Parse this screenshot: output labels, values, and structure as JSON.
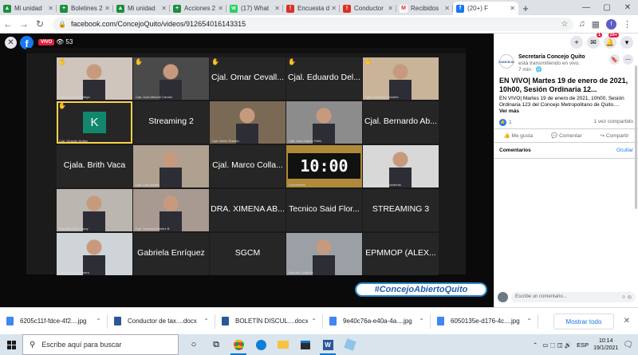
{
  "browser": {
    "tabs": [
      {
        "label": "Mi unidad",
        "color": "#1e8e3e",
        "glyph": "▲"
      },
      {
        "label": "Boletines 2",
        "color": "#1e8e3e",
        "glyph": "+"
      },
      {
        "label": "Mi unidad",
        "color": "#1e8e3e",
        "glyph": "▲"
      },
      {
        "label": "Acciones 2",
        "color": "#1e8e3e",
        "glyph": "+"
      },
      {
        "label": "(17) What",
        "color": "#25d366",
        "glyph": "w"
      },
      {
        "label": "Encuesta d",
        "color": "#d93025",
        "glyph": "!"
      },
      {
        "label": "Conductor",
        "color": "#d93025",
        "glyph": "!"
      },
      {
        "label": "Recibidos",
        "color": "#ffffff",
        "glyph": "M"
      },
      {
        "label": "(20+) F",
        "color": "#1877f2",
        "glyph": "f"
      }
    ],
    "url": "facebook.com/ConcejoQuito/videos/912654016143315",
    "profile_initial": "f"
  },
  "video": {
    "live_label": "VIVO",
    "viewers": "53",
    "hashtag": "#ConcejoAbiertoQuito",
    "clock": "10:00",
    "tiles": [
      {
        "row": 0,
        "col": 0,
        "name": "",
        "cap": "Cjala. Andrea Hidalgo",
        "hand": true,
        "photo": true,
        "bg": "#cfc5bd"
      },
      {
        "row": 0,
        "col": 1,
        "name": "",
        "cap": "Cjal. Juan Manuel Carrion",
        "hand": true,
        "photo": true,
        "bg": "#4a4a4a"
      },
      {
        "row": 0,
        "col": 2,
        "name": "Cjal. Omar Cevall...",
        "cap": "",
        "hand": true,
        "photo": false
      },
      {
        "row": 0,
        "col": 3,
        "name": "Cjal. Eduardo Del...",
        "cap": "",
        "hand": true,
        "photo": false
      },
      {
        "row": 0,
        "col": 4,
        "name": "",
        "cap": "Cjal. Fernando Morales",
        "hand": true,
        "photo": true,
        "bg": "#c9b49a"
      },
      {
        "row": 1,
        "col": 0,
        "name": "",
        "cap": "Cjal. Orlando Núñez",
        "hand": true,
        "photo": false,
        "avatar": "K",
        "selected": true
      },
      {
        "row": 1,
        "col": 1,
        "name": "Streaming 2",
        "cap": "",
        "hand": false,
        "photo": false
      },
      {
        "row": 1,
        "col": 2,
        "name": "",
        "cap": "Cjal. Mario Granda",
        "hand": false,
        "photo": true,
        "bg": "#7a6a55"
      },
      {
        "row": 1,
        "col": 3,
        "name": "",
        "cap": "Cjal. Juan Carlos Fiallo",
        "hand": false,
        "photo": true,
        "bg": "#8c8c8c"
      },
      {
        "row": 1,
        "col": 4,
        "name": "Cjal. Bernardo Ab...",
        "cap": "",
        "hand": false,
        "photo": false
      },
      {
        "row": 2,
        "col": 0,
        "name": "Cjala. Brith Vaca",
        "cap": "",
        "hand": false,
        "photo": false
      },
      {
        "row": 2,
        "col": 1,
        "name": "",
        "cap": "Cjal. Luis Robles",
        "hand": false,
        "photo": true,
        "bg": "#b0a090"
      },
      {
        "row": 2,
        "col": 2,
        "name": "Cjal. Marco Colla...",
        "cap": "",
        "hand": false,
        "photo": false
      },
      {
        "row": 2,
        "col": 3,
        "name": "",
        "cap": "Cronómetro",
        "hand": false,
        "photo": false,
        "clock": true
      },
      {
        "row": 2,
        "col": 4,
        "name": "",
        "cap": "Cjal. Santiago Guarderas",
        "hand": false,
        "photo": true,
        "bg": "#d8d8d8"
      },
      {
        "row": 3,
        "col": 0,
        "name": "",
        "cap": "Damaris Ortiz Pasuy",
        "hand": false,
        "photo": true,
        "bg": "#bcb6b0"
      },
      {
        "row": 3,
        "col": 1,
        "name": "",
        "cap": "Cjal. Soledad Benítez B.",
        "hand": false,
        "photo": true,
        "bg": "#a89a90"
      },
      {
        "row": 3,
        "col": 2,
        "name": "DRA. XIMENA AB...",
        "cap": "",
        "hand": false,
        "photo": false
      },
      {
        "row": 3,
        "col": 3,
        "name": "Tecnico Said Flor...",
        "cap": "",
        "hand": false,
        "photo": false
      },
      {
        "row": 3,
        "col": 4,
        "name": "STREAMING 3",
        "cap": "",
        "hand": false,
        "photo": false
      },
      {
        "row": 4,
        "col": 0,
        "name": "",
        "cap": "Luis Reina Chamorro",
        "hand": false,
        "photo": true,
        "bg": "#cfd4d8"
      },
      {
        "row": 4,
        "col": 1,
        "name": "Gabriela Enríquez",
        "cap": "",
        "hand": false,
        "photo": false
      },
      {
        "row": 4,
        "col": 2,
        "name": "SGCM",
        "cap": "",
        "hand": false,
        "photo": false
      },
      {
        "row": 4,
        "col": 3,
        "name": "",
        "cap": "Marcelo Ordóñez",
        "hand": false,
        "photo": true,
        "bg": "#9aa0a6"
      },
      {
        "row": 4,
        "col": 4,
        "name": "EPMMOP (ALEX...",
        "cap": "",
        "hand": false,
        "photo": false
      }
    ]
  },
  "panel": {
    "page_name": "Secretaría Concejo Quito",
    "status": "está transmitiendo en vivo.",
    "time": "7 min · 🌐",
    "logo_text": "CONCEJO",
    "title": "EN VIVO| Martes 19 de enero de 2021, 10h00, Sesión Ordinaria 12...",
    "description": "EN VIVO| Martes 19 de enero de 2021, 10h00, Sesión Ordinaria 123 del Concejo Metropolitano de Quito....",
    "see_more": "Ver más",
    "likes": "1",
    "shares": "1 vez compartido",
    "like_btn": "Me gusta",
    "comment_btn": "Comentar",
    "share_btn": "Compartir",
    "comments_label": "Comentarios",
    "hide_label": "Ocultar",
    "comment_placeholder": "Escribe un comentario...",
    "messenger_badge": "1",
    "notif_badge": "20+"
  },
  "downloads": {
    "items": [
      {
        "name": "6205c11f-fdce-4f2....jpg",
        "color": "#4285f4"
      },
      {
        "name": "Conductor de tax....docx",
        "color": "#2b579a"
      },
      {
        "name": "BOLETÍN DISCUL....docx",
        "color": "#2b579a"
      },
      {
        "name": "9e40c76a-e40a-4a....jpg",
        "color": "#4285f4"
      },
      {
        "name": "6050135e-d176-4c....jpg",
        "color": "#4285f4"
      }
    ],
    "show_all": "Mostrar todo"
  },
  "taskbar": {
    "search_placeholder": "Escribe aquí para buscar",
    "lang": "ESP",
    "time": "10:14",
    "date": "19/1/2021"
  }
}
